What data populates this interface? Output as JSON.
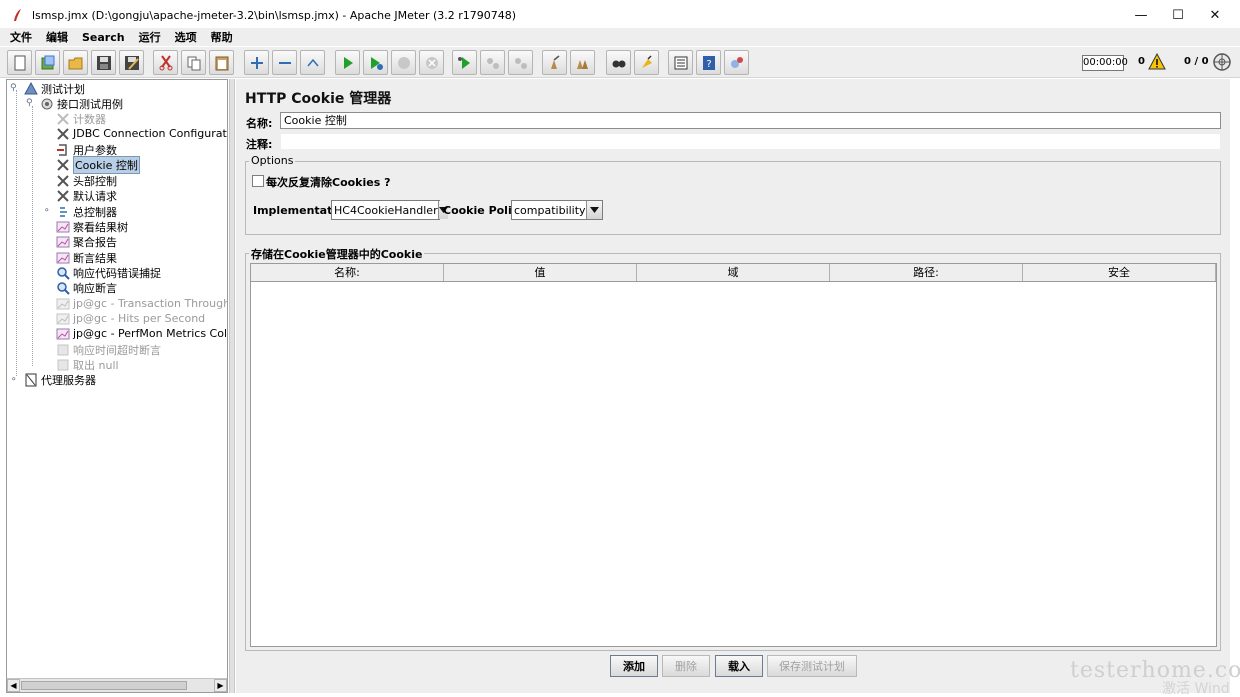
{
  "window": {
    "title": "lsmsp.jmx (D:\\gongju\\apache-jmeter-3.2\\bin\\lsmsp.jmx) - Apache JMeter (3.2 r1790748)",
    "controls": [
      "—",
      "☐",
      "✕"
    ]
  },
  "menu": [
    "文件",
    "编辑",
    "Search",
    "运行",
    "选项",
    "帮助"
  ],
  "toolbar": {
    "buttons": [
      {
        "name": "new-icon",
        "enabled": true
      },
      {
        "name": "templates-icon",
        "enabled": true
      },
      {
        "name": "open-icon",
        "enabled": true
      },
      {
        "name": "save-icon",
        "enabled": true
      },
      {
        "name": "save-as-icon",
        "enabled": true
      },
      {
        "name": "cut-icon",
        "enabled": true
      },
      {
        "name": "copy-icon",
        "enabled": true
      },
      {
        "name": "paste-icon",
        "enabled": true
      },
      {
        "name": "expand-icon",
        "enabled": true
      },
      {
        "name": "collapse-icon",
        "enabled": true
      },
      {
        "name": "toggle-icon",
        "enabled": true
      },
      {
        "name": "start-icon",
        "enabled": true
      },
      {
        "name": "start-no-pause-icon",
        "enabled": true
      },
      {
        "name": "stop-icon",
        "enabled": false
      },
      {
        "name": "shutdown-icon",
        "enabled": false
      },
      {
        "name": "remote-start-icon",
        "enabled": true
      },
      {
        "name": "remote-stop-icon",
        "enabled": false
      },
      {
        "name": "remote-shutdown-icon",
        "enabled": false
      },
      {
        "name": "clear-icon",
        "enabled": true
      },
      {
        "name": "clear-all-icon",
        "enabled": true
      },
      {
        "name": "search-icon",
        "enabled": true
      },
      {
        "name": "reset-search-icon",
        "enabled": true
      },
      {
        "name": "function-helper-icon",
        "enabled": true
      },
      {
        "name": "help-icon",
        "enabled": true
      },
      {
        "name": "remote-icon",
        "enabled": true
      }
    ],
    "timer": "00:00:00",
    "error_count": "0",
    "threads": "0 / 0"
  },
  "tree": {
    "nodes": [
      {
        "label": "测试计划",
        "icon": "test-plan-icon",
        "level": 0,
        "dim": false,
        "selected": false,
        "expander": "⚲"
      },
      {
        "label": "接口测试用例",
        "icon": "thread-group-icon",
        "level": 1,
        "dim": false,
        "selected": false,
        "expander": "⚲"
      },
      {
        "label": "计数器",
        "icon": "config-element-icon",
        "level": 2,
        "dim": true,
        "selected": false
      },
      {
        "label": "JDBC Connection Configuration",
        "icon": "config-element-icon",
        "level": 2,
        "dim": false,
        "selected": false
      },
      {
        "label": "用户参数",
        "icon": "pre-processor-icon",
        "level": 2,
        "dim": false,
        "selected": false
      },
      {
        "label": "Cookie 控制",
        "icon": "config-element-icon",
        "level": 2,
        "dim": false,
        "selected": true
      },
      {
        "label": "头部控制",
        "icon": "config-element-icon",
        "level": 2,
        "dim": false,
        "selected": false
      },
      {
        "label": "默认请求",
        "icon": "config-element-icon",
        "level": 2,
        "dim": false,
        "selected": false
      },
      {
        "label": "总控制器",
        "icon": "controller-icon",
        "level": 2,
        "dim": false,
        "selected": false,
        "expander": "⚬"
      },
      {
        "label": "察看结果树",
        "icon": "listener-icon",
        "level": 2,
        "dim": false,
        "selected": false
      },
      {
        "label": "聚合报告",
        "icon": "listener-icon",
        "level": 2,
        "dim": false,
        "selected": false
      },
      {
        "label": "断言结果",
        "icon": "listener-icon",
        "level": 2,
        "dim": false,
        "selected": false
      },
      {
        "label": "响应代码错误捕捉",
        "icon": "assertion-icon",
        "level": 2,
        "dim": false,
        "selected": false
      },
      {
        "label": "响应断言",
        "icon": "assertion-icon",
        "level": 2,
        "dim": false,
        "selected": false
      },
      {
        "label": "jp@gc - Transaction Throughput vs",
        "icon": "listener-icon",
        "level": 2,
        "dim": true,
        "selected": false
      },
      {
        "label": "jp@gc - Hits per Second",
        "icon": "listener-icon",
        "level": 2,
        "dim": true,
        "selected": false
      },
      {
        "label": "jp@gc - PerfMon Metrics Collector",
        "icon": "listener-icon",
        "level": 2,
        "dim": false,
        "selected": false
      },
      {
        "label": "响应时间超时断言",
        "icon": "assertion-icon",
        "level": 2,
        "dim": true,
        "selected": false
      },
      {
        "label": "取出 null",
        "icon": "post-processor-icon",
        "level": 2,
        "dim": true,
        "selected": false
      },
      {
        "label": "代理服务器",
        "icon": "workbench-icon",
        "level": 0,
        "dim": false,
        "selected": false,
        "expander": "⚬"
      }
    ]
  },
  "panel": {
    "title": "HTTP Cookie 管理器",
    "name_label": "名称:",
    "name_value": "Cookie 控制",
    "comment_label": "注释:",
    "comment_value": "",
    "options": {
      "title": "Options",
      "clear_each_iteration_label": "每次反复清除Cookies ?",
      "clear_each_iteration_checked": false,
      "implementation_label": "Implementation:",
      "implementation_value": "HC4CookieHandler",
      "policy_label": "Cookie Policy:",
      "policy_value": "compatibility"
    },
    "stored": {
      "title": "存储在Cookie管理器中的Cookie",
      "columns": [
        "名称:",
        "值",
        "域",
        "路径:",
        "安全"
      ],
      "rows": []
    },
    "buttons": {
      "add": "添加",
      "delete": "删除",
      "load": "载入",
      "save": "保存测试计划"
    }
  },
  "watermark": {
    "site": "testerhome.com",
    "activation": "激活 Wind"
  }
}
